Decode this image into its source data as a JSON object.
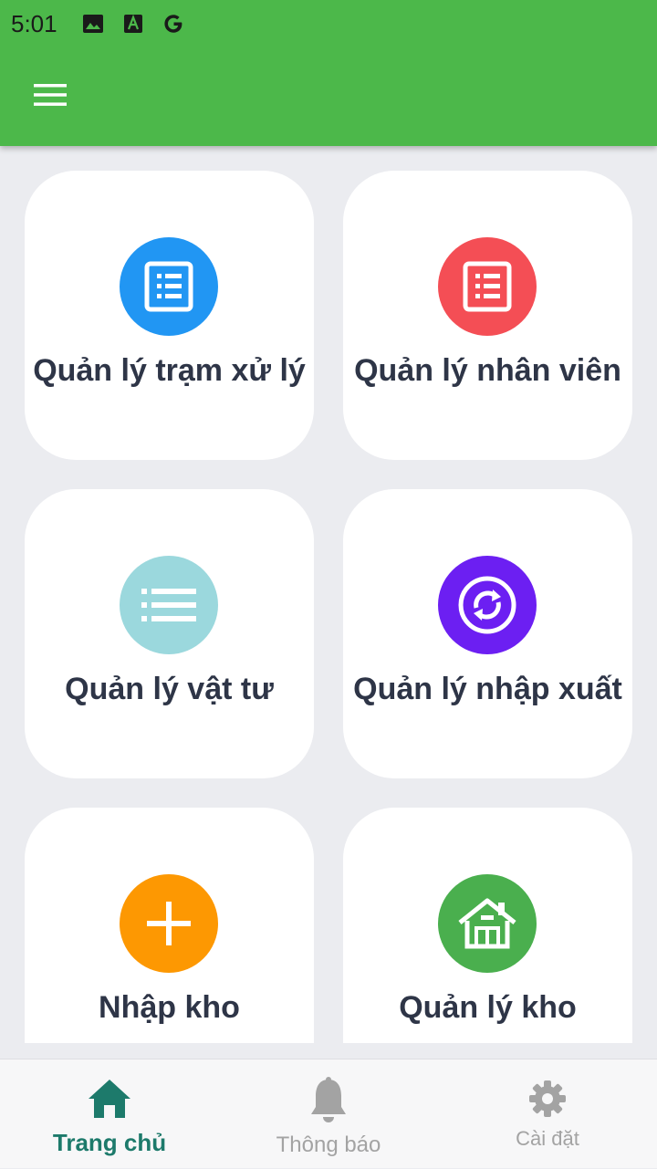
{
  "status_bar": {
    "time": "5:01",
    "icons": [
      "image-icon",
      "font-a-icon",
      "google-g-icon"
    ]
  },
  "app_bar": {
    "menu_icon": "hamburger-menu-icon",
    "color": "#4cb84a"
  },
  "cards": [
    {
      "label": "Quản lý trạm xử lý",
      "icon": "form-list-icon",
      "color": "#2196f3"
    },
    {
      "label": "Quản lý nhân viên",
      "icon": "form-list-icon",
      "color": "#f44e55"
    },
    {
      "label": "Quản lý vật tư",
      "icon": "list-icon",
      "color": "#9bd8dd"
    },
    {
      "label": "Quản lý nhập xuất",
      "icon": "sync-icon",
      "color": "#6c1ff2"
    },
    {
      "label": "Nhập kho",
      "icon": "plus-icon",
      "color": "#fd9802"
    },
    {
      "label": "Quản lý kho",
      "icon": "house-icon",
      "color": "#4aaf4e"
    }
  ],
  "bottom_nav": {
    "items": [
      {
        "label": "Trang chủ",
        "icon": "home-icon",
        "active": true
      },
      {
        "label": "Thông báo",
        "icon": "bell-icon",
        "active": false
      },
      {
        "label": "Cài đặt",
        "icon": "gear-icon",
        "active": false
      }
    ],
    "active_color": "#1d7a6b",
    "inactive_color": "#a3a3a3"
  }
}
